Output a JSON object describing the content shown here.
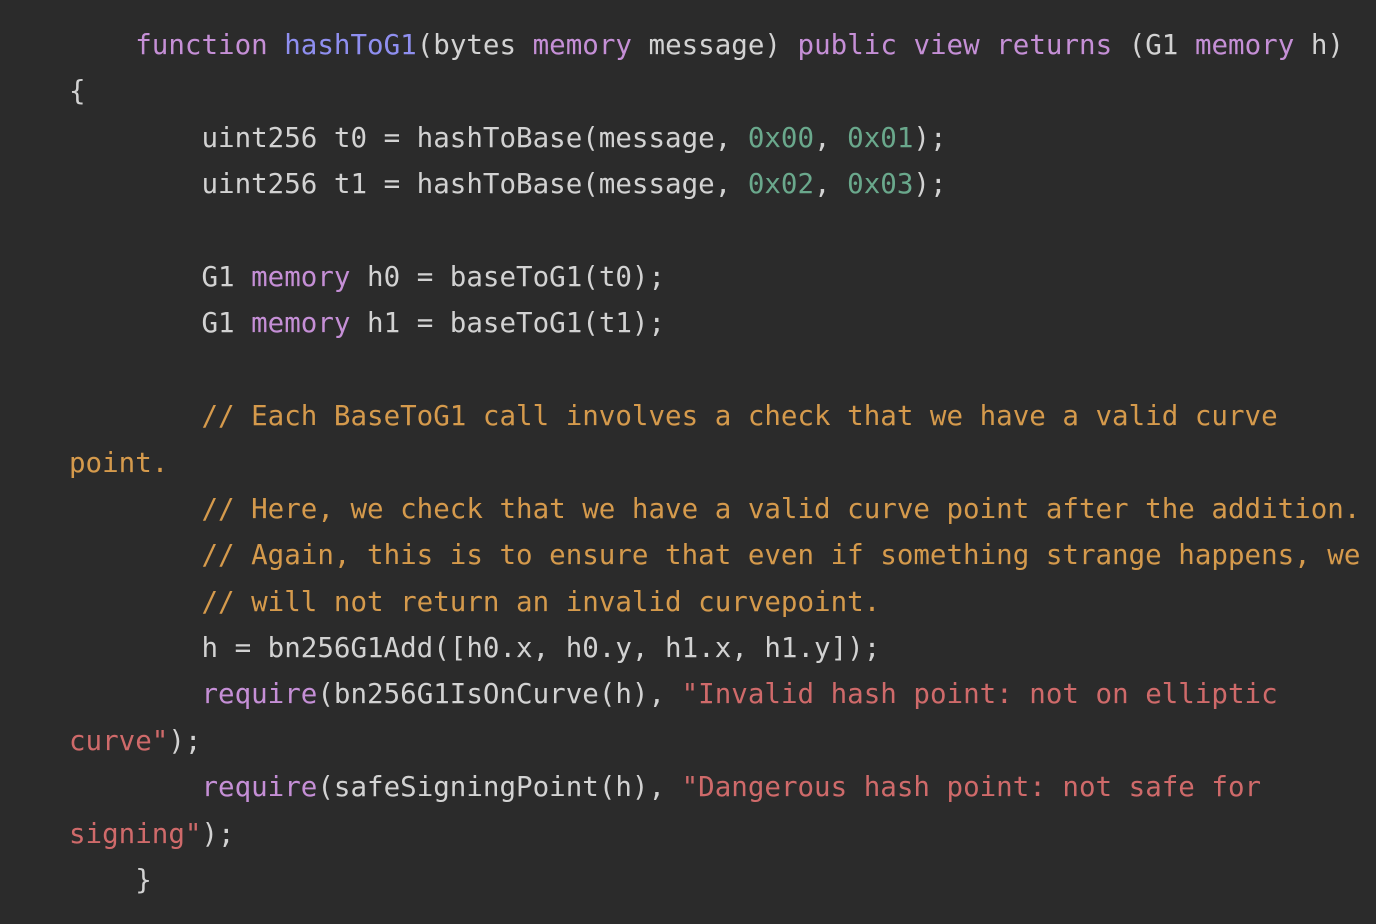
{
  "colors": {
    "background": "#2b2b2b",
    "default": "#d2d2d2",
    "keyword": "#c58fd6",
    "function_name": "#8f8ff0",
    "number": "#6aa88c",
    "comment": "#d59a4c",
    "string": "#cf6a6a"
  },
  "code": {
    "lines": [
      [
        {
          "t": "    ",
          "c": "default"
        },
        {
          "t": "function",
          "c": "keyword"
        },
        {
          "t": " ",
          "c": "default"
        },
        {
          "t": "hashToG1",
          "c": "function_name"
        },
        {
          "t": "(bytes ",
          "c": "default"
        },
        {
          "t": "memory",
          "c": "keyword"
        },
        {
          "t": " message) ",
          "c": "default"
        },
        {
          "t": "public",
          "c": "keyword"
        },
        {
          "t": " ",
          "c": "default"
        },
        {
          "t": "view",
          "c": "keyword"
        },
        {
          "t": " ",
          "c": "default"
        },
        {
          "t": "returns",
          "c": "keyword"
        },
        {
          "t": " (G1 ",
          "c": "default"
        },
        {
          "t": "memory",
          "c": "keyword"
        },
        {
          "t": " h)",
          "c": "default"
        }
      ],
      [
        {
          "t": "{",
          "c": "default"
        }
      ],
      [
        {
          "t": "        uint256 t0 = hashToBase(message, ",
          "c": "default"
        },
        {
          "t": "0x00",
          "c": "number"
        },
        {
          "t": ", ",
          "c": "default"
        },
        {
          "t": "0x01",
          "c": "number"
        },
        {
          "t": ");",
          "c": "default"
        }
      ],
      [
        {
          "t": "        uint256 t1 = hashToBase(message, ",
          "c": "default"
        },
        {
          "t": "0x02",
          "c": "number"
        },
        {
          "t": ", ",
          "c": "default"
        },
        {
          "t": "0x03",
          "c": "number"
        },
        {
          "t": ");",
          "c": "default"
        }
      ],
      [],
      [
        {
          "t": "        G1 ",
          "c": "default"
        },
        {
          "t": "memory",
          "c": "keyword"
        },
        {
          "t": " h0 = baseToG1(t0);",
          "c": "default"
        }
      ],
      [
        {
          "t": "        G1 ",
          "c": "default"
        },
        {
          "t": "memory",
          "c": "keyword"
        },
        {
          "t": " h1 = baseToG1(t1);",
          "c": "default"
        }
      ],
      [],
      [
        {
          "t": "        ",
          "c": "default"
        },
        {
          "t": "// Each BaseToG1 call involves a check that we have a valid curve",
          "c": "comment"
        }
      ],
      [
        {
          "t": "point.",
          "c": "comment"
        }
      ],
      [
        {
          "t": "        ",
          "c": "default"
        },
        {
          "t": "// Here, we check that we have a valid curve point after the addition.",
          "c": "comment"
        }
      ],
      [
        {
          "t": "        ",
          "c": "default"
        },
        {
          "t": "// Again, this is to ensure that even if something strange happens, we",
          "c": "comment"
        }
      ],
      [
        {
          "t": "        ",
          "c": "default"
        },
        {
          "t": "// will not return an invalid curvepoint.",
          "c": "comment"
        }
      ],
      [
        {
          "t": "        h = bn256G1Add([h0.x, h0.y, h1.x, h1.y]);",
          "c": "default"
        }
      ],
      [
        {
          "t": "        ",
          "c": "default"
        },
        {
          "t": "require",
          "c": "keyword"
        },
        {
          "t": "(bn256G1IsOnCurve(h), ",
          "c": "default"
        },
        {
          "t": "\"Invalid hash point: not on elliptic",
          "c": "string"
        }
      ],
      [
        {
          "t": "curve\"",
          "c": "string"
        },
        {
          "t": ");",
          "c": "default"
        }
      ],
      [
        {
          "t": "        ",
          "c": "default"
        },
        {
          "t": "require",
          "c": "keyword"
        },
        {
          "t": "(safeSigningPoint(h), ",
          "c": "default"
        },
        {
          "t": "\"Dangerous hash point: not safe for",
          "c": "string"
        }
      ],
      [
        {
          "t": "signing\"",
          "c": "string"
        },
        {
          "t": ");",
          "c": "default"
        }
      ],
      [
        {
          "t": "    }",
          "c": "default"
        }
      ]
    ]
  }
}
